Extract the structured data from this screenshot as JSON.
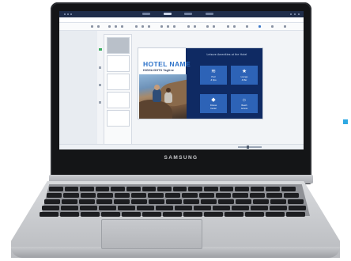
{
  "laptop": {
    "brand": "SAMSUNG"
  },
  "slide": {
    "title": "HOTEL NAME",
    "subtitle": "HIGHLIGHTS Tagline",
    "heading": "Leisure Amenities at the Hotel",
    "tiles": [
      {
        "icon": "pool-icon",
        "glyph": "≋",
        "line1": "Pool",
        "line2": "& Spa"
      },
      {
        "icon": "star-icon",
        "glyph": "★",
        "line1": "Lounge",
        "line2": "& Bar"
      },
      {
        "icon": "drop-icon",
        "glyph": "◆",
        "line1": "Fitness",
        "line2": "Center"
      },
      {
        "icon": "sun-icon",
        "glyph": "☼",
        "line1": "Beach",
        "line2": "Access"
      }
    ]
  },
  "colors": {
    "slide_blue": "#0f2a63",
    "tile_blue": "#2d63b7",
    "accent_blue": "#2c72c9",
    "side_marker": "#2fa9e3"
  }
}
